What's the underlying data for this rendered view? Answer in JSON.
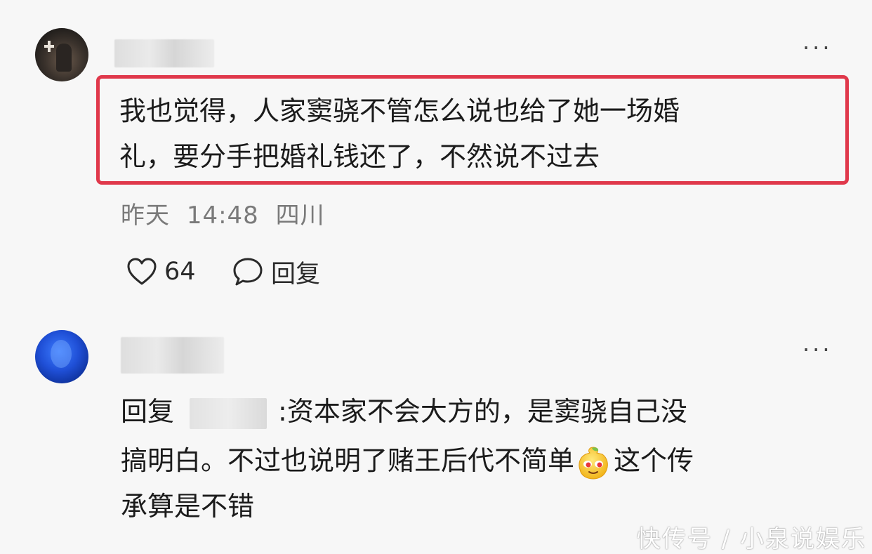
{
  "comments": [
    {
      "avatar_icon": "user-avatar-icon",
      "more_label": "···",
      "text_line1": "我也觉得，人家窦骁不管怎么说也给了她一场婚",
      "text_line2": "礼，要分手把婚礼钱还了，不然说不过去",
      "highlight_color": "#e0384b",
      "date": "昨天",
      "time": "14:48",
      "location": "四川",
      "like_icon": "heart-icon",
      "like_count": "64",
      "reply_icon": "comment-bubble-icon",
      "reply_label": "回复"
    },
    {
      "avatar_icon": "user-avatar-icon",
      "more_label": "···",
      "reply_prefix": "回复",
      "line1_rest": ":资本家不会大方的，是窦骁自己没",
      "line2_part1": "搞明白。不过也说明了赌王后代不简单",
      "emoji": "smirk-emoji-icon",
      "line2_part2": "这个传",
      "line3": "承算是不错"
    }
  ],
  "watermark": "快传号 / 小泉说娱乐"
}
